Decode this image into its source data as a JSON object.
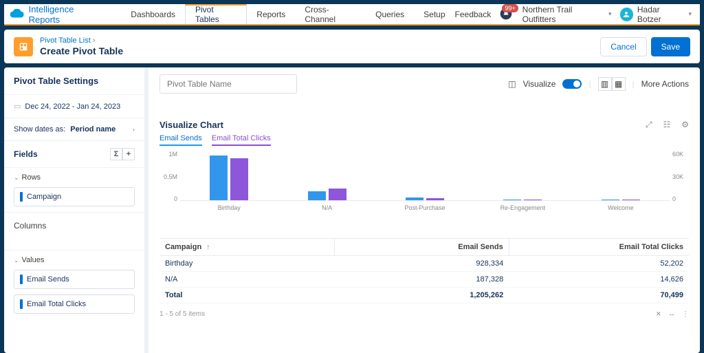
{
  "app": {
    "title": "Intelligence Reports"
  },
  "nav": {
    "tabs": [
      "Dashboards",
      "Pivot Tables",
      "Reports",
      "Cross-Channel",
      "Queries",
      "Setup"
    ],
    "active_index": 1,
    "feedback": "Feedback",
    "badge": "99+",
    "org": "Northern Trail Outfitters",
    "user": "Hadar Botzer"
  },
  "header": {
    "breadcrumb": "Pivot Table List",
    "title": "Create Pivot Table",
    "cancel": "Cancel",
    "save": "Save"
  },
  "sidebar": {
    "settings_title": "Pivot Table Settings",
    "date_range": "Dec 24, 2022 - Jan 24, 2023",
    "show_dates_label": "Show dates as:",
    "period": "Period name",
    "fields_label": "Fields",
    "rows_label": "Rows",
    "row_pill": "Campaign",
    "columns_label": "Columns",
    "values_label": "Values",
    "value_pills": [
      "Email Sends",
      "Email Total Clicks"
    ]
  },
  "main": {
    "name_placeholder": "Pivot Table Name",
    "visualize_label": "Visualize",
    "more_actions": "More Actions"
  },
  "chart": {
    "title": "Visualize Chart",
    "series_tabs": [
      "Email Sends",
      "Email Total Clicks"
    ]
  },
  "chart_data": {
    "type": "bar",
    "categories": [
      "Birthday",
      "N/A",
      "Post-Purchase",
      "Re-Engagement",
      "Welcome"
    ],
    "series": [
      {
        "name": "Email Sends",
        "color": "#3296ed",
        "axis": "left",
        "values": [
          928334,
          187328,
          60000,
          10000,
          20000
        ]
      },
      {
        "name": "Email Total Clicks",
        "color": "#8e56d8",
        "axis": "right",
        "values": [
          52202,
          14626,
          3000,
          0,
          600
        ]
      }
    ],
    "y_left": {
      "ticks": [
        "1M",
        "0.5M",
        "0"
      ],
      "max": 1000000
    },
    "y_right": {
      "ticks": [
        "60K",
        "30K",
        "0"
      ],
      "max": 60000
    }
  },
  "table": {
    "columns": [
      "Campaign",
      "Email Sends",
      "Email Total Clicks"
    ],
    "rows": [
      {
        "c": "Birthday",
        "s": "928,334",
        "k": "52,202"
      },
      {
        "c": "N/A",
        "s": "187,328",
        "k": "14,626"
      }
    ],
    "total_label": "Total",
    "total_sends": "1,205,262",
    "total_clicks": "70,499",
    "footer": "1 - 5 of 5 items"
  }
}
